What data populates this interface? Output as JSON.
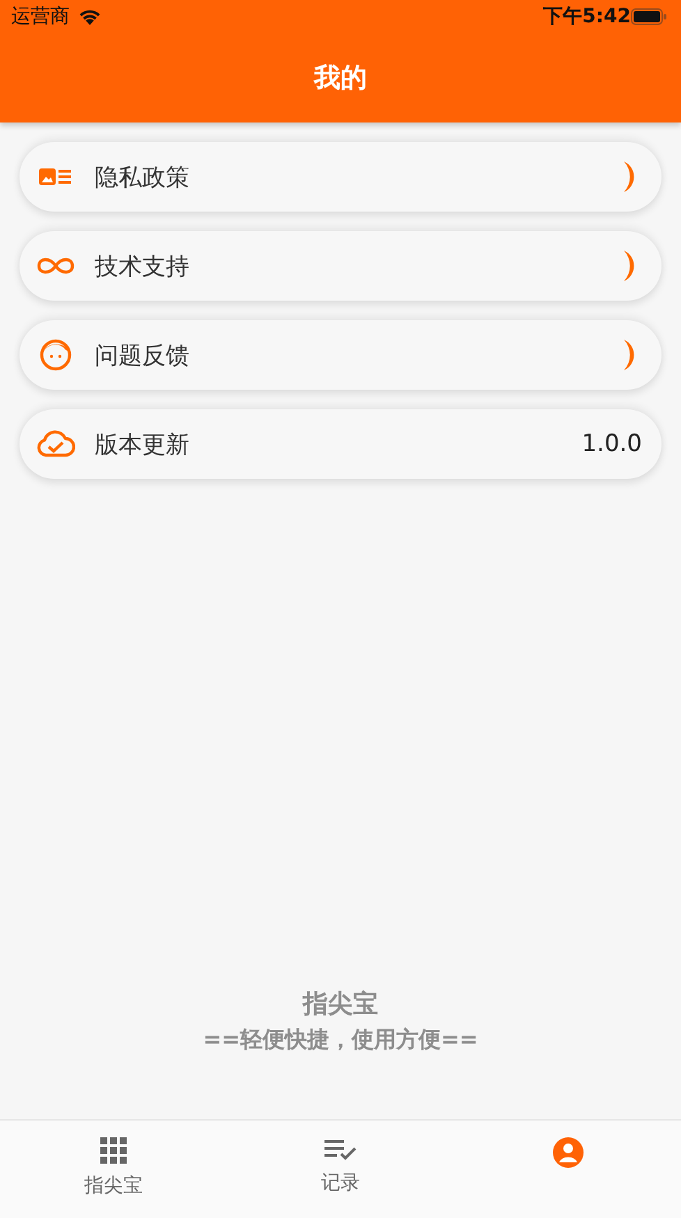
{
  "status_bar": {
    "carrier": "运营商",
    "time": "下午5:42"
  },
  "nav": {
    "title": "我的"
  },
  "menu": [
    {
      "label": "隐私政策",
      "kind": "arrow"
    },
    {
      "label": "技术支持",
      "kind": "arrow"
    },
    {
      "label": "问题反馈",
      "kind": "arrow"
    },
    {
      "label": "版本更新",
      "kind": "value",
      "value": "1.0.0"
    }
  ],
  "footer": {
    "app_name": "指尖宝",
    "slogan": "==轻便快捷，使用方便=="
  },
  "tabs": [
    {
      "label": "指尖宝",
      "selected": false
    },
    {
      "label": "记录",
      "selected": false
    },
    {
      "selected": true
    }
  ]
}
